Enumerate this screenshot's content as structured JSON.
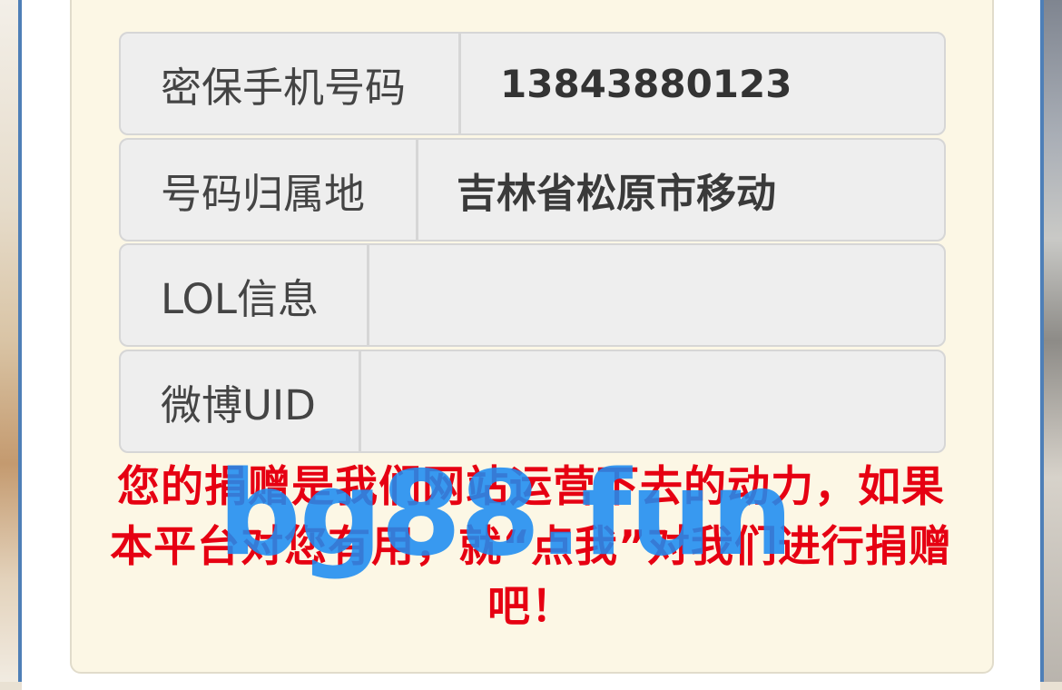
{
  "form": {
    "rows": [
      {
        "label": "密保手机号码",
        "value": "13843880123"
      },
      {
        "label": "号码归属地",
        "value": "吉林省松原市移动"
      },
      {
        "label": "LOL信息",
        "value": ""
      },
      {
        "label": "微博UID",
        "value": ""
      }
    ]
  },
  "notice": {
    "text": "您的捐赠是我们网站运营下去的动力，如果本平台对您有用，就“点我”对我们进行捐赠吧！"
  },
  "watermark": {
    "text": "bg88.fun"
  },
  "colors": {
    "notice": "#e60012",
    "watermark": "#1e8df2",
    "card_bg": "#fcf7e5",
    "row_bg": "#eeeeee"
  }
}
